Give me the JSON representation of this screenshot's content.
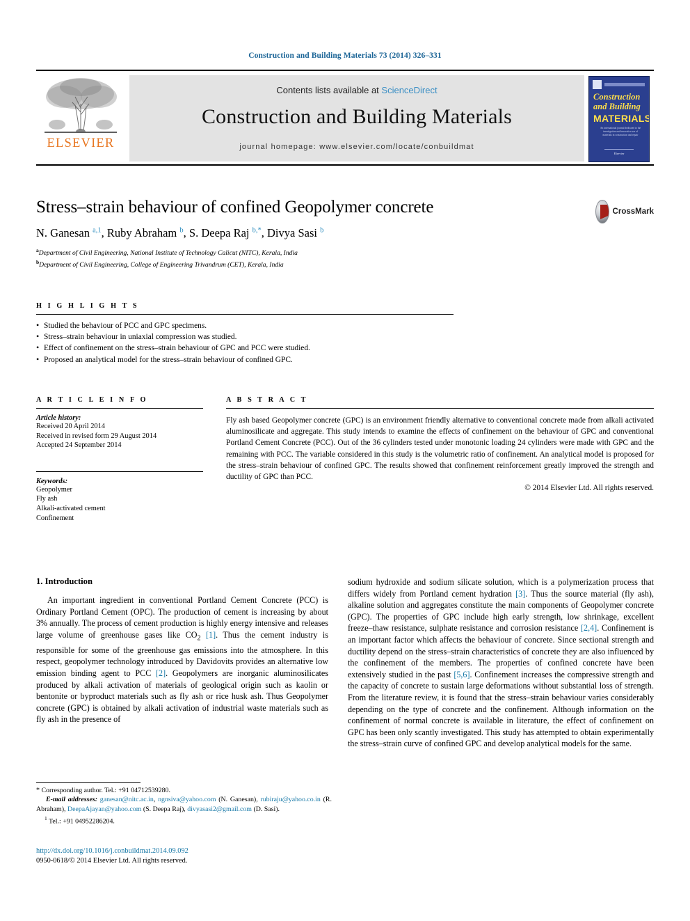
{
  "running_head": "Construction and Building Materials 73 (2014) 326–331",
  "masthead": {
    "publisher_name": "ELSEVIER",
    "contents_prefix": "Contents lists available at ",
    "contents_link": "ScienceDirect",
    "journal_title": "Construction and Building Materials",
    "homepage": "journal homepage: www.elsevier.com/locate/conbuildmat",
    "cover": {
      "line1": "Construction",
      "line2": "and Building",
      "line3": "MATERIALS",
      "blurb": "An international journal dedicated to the investigation and innovative use of materials in construction and repair",
      "footer": "Elsevier"
    }
  },
  "article": {
    "title": "Stress–strain behaviour of confined Geopolymer concrete",
    "crossmark_label": "CrossMark",
    "authors_html": "N. Ganesan <sup>a,1</sup>, Ruby Abraham <sup>b</sup>, S. Deepa Raj <sup>b,*</sup>, Divya Sasi <sup>b</sup>",
    "affiliations": [
      {
        "mark": "a",
        "text": "Department of Civil Engineering, National Institute of Technology Calicut (NITC), Kerala, India"
      },
      {
        "mark": "b",
        "text": "Department of Civil Engineering, College of Engineering Trivandrum (CET), Kerala, India"
      }
    ]
  },
  "highlights": {
    "label": "H I G H L I G H T S",
    "items": [
      "Studied the behaviour of PCC and GPC specimens.",
      "Stress–strain behaviour in uniaxial compression was studied.",
      "Effect of confinement on the stress–strain behaviour of GPC and PCC were studied.",
      "Proposed an analytical model for the stress–strain behaviour of confined GPC."
    ]
  },
  "article_info": {
    "label": "A R T I C L E    I N F O",
    "history_title": "Article history:",
    "history": [
      "Received 20 April 2014",
      "Received in revised form 29 August 2014",
      "Accepted 24 September 2014"
    ],
    "keywords_title": "Keywords:",
    "keywords": [
      "Geopolymer",
      "Fly ash",
      "Alkali-activated cement",
      "Confinement"
    ]
  },
  "abstract": {
    "label": "A B S T R A C T",
    "text": "Fly ash based Geopolymer concrete (GPC) is an environment friendly alternative to conventional concrete made from alkali activated aluminosilicate and aggregate. This study intends to examine the effects of confinement on the behaviour of GPC and conventional Portland Cement Concrete (PCC). Out of the 36 cylinders tested under monotonic loading 24 cylinders were made with GPC and the remaining with PCC. The variable considered in this study is the volumetric ratio of confinement. An analytical model is proposed for the stress–strain behaviour of confined GPC. The results showed that confinement reinforcement greatly improved the strength and ductility of GPC than PCC.",
    "copyright": "© 2014 Elsevier Ltd. All rights reserved."
  },
  "body": {
    "section_heading": "1. Introduction",
    "left_para_1_a": "An important ingredient in conventional Portland Cement Concrete (PCC) is Ordinary Portland Cement (OPC). The production of cement is increasing by about 3% annually. The process of cement production is highly energy intensive and releases large volume of greenhouse gases like CO",
    "left_para_1_sub": "2",
    "left_ref_1": "[1]",
    "left_para_1_b": ". Thus the cement industry is responsible for some of the greenhouse gas emissions into the atmosphere. In this respect, geopolymer technology introduced by Davidovits provides an alternative low emission binding agent to PCC ",
    "left_ref_2": "[2]",
    "left_para_1_c": ". Geopolymers are inorganic aluminosilicates produced by alkali activation of materials of geological origin such as kaolin or bentonite or byproduct materials such as fly ash or rice husk ash. Thus Geopolymer concrete (GPC) is obtained by alkali activation of industrial waste materials such as fly ash in the presence of",
    "right_para_a": "sodium hydroxide and sodium silicate solution, which is a polymerization process that differs widely from Portland cement hydration ",
    "right_ref_3": "[3]",
    "right_para_b": ". Thus the source material (fly ash), alkaline solution and aggregates constitute the main components of Geopolymer concrete (GPC). The properties of GPC include high early strength, low shrinkage, excellent freeze–thaw resistance, sulphate resistance and corrosion resistance ",
    "right_ref_24": "[2,4]",
    "right_para_c": ". Confinement is an important factor which affects the behaviour of concrete. Since sectional strength and ductility depend on the stress–strain characteristics of concrete they are also influenced by the confinement of the members. The properties of confined concrete have been extensively studied in the past ",
    "right_ref_56": "[5,6]",
    "right_para_d": ". Confinement increases the compressive strength and the capacity of concrete to sustain large deformations without substantial loss of strength. From the literature review, it is found that the stress–strain behaviour varies considerably depending on the type of concrete and the confinement. Although information on the confinement of normal concrete is available in literature, the effect of confinement on GPC has been only scantly investigated. This study has attempted to obtain experimentally the stress–strain curve of confined GPC and develop analytical models for the same."
  },
  "footnotes": {
    "corresponding_mark": "*",
    "corresponding_text": "Corresponding author. Tel.: +91 04712539280.",
    "email_label": "E-mail addresses:",
    "emails": [
      {
        "address": "ganesan@nitc.ac.in",
        "sep": ", "
      },
      {
        "address": "ngnsiva@yahoo.com",
        "owner": " (N. Ganesan), "
      },
      {
        "address": "rubiraju@yahoo.co.in",
        "owner": " (R. Abraham), "
      },
      {
        "address": "DeepaAjayan@yahoo.com",
        "owner": " (S. Deepa Raj), "
      },
      {
        "address": "divyasasi2@gmail.com",
        "owner": " (D. Sasi)."
      }
    ],
    "tel_mark": "1",
    "tel_text": "Tel.: +91 04952286204."
  },
  "footer": {
    "doi": "http://dx.doi.org/10.1016/j.conbuildmat.2014.09.092",
    "issn_line": "0950-0618/© 2014 Elsevier Ltd. All rights reserved."
  }
}
